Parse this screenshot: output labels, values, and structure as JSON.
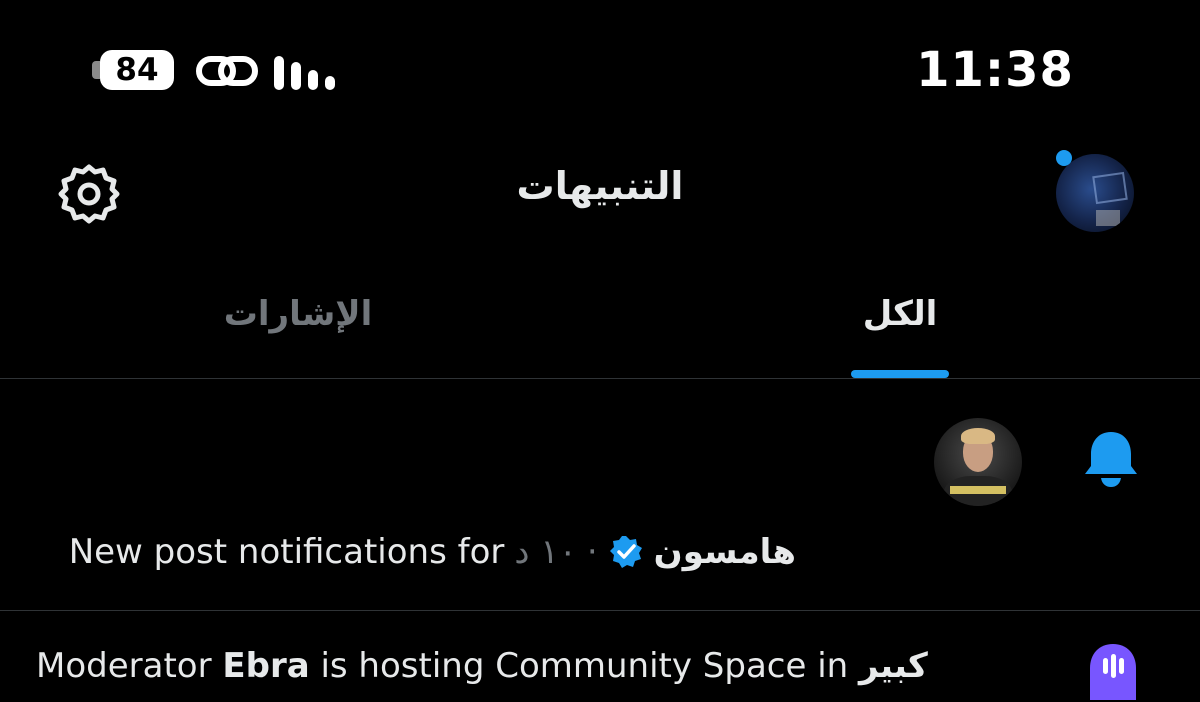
{
  "status_bar": {
    "battery": "84",
    "time": "11:38"
  },
  "header": {
    "title": "التنبيهات"
  },
  "tabs": [
    {
      "label": "الكل",
      "active": true
    },
    {
      "label": "الإشارات",
      "active": false
    }
  ],
  "notifications": [
    {
      "name": "هامسون",
      "time": "١٠ د",
      "text": "New post notifications for",
      "icon": "bell-icon",
      "verified": true
    },
    {
      "prefix": "Moderator ",
      "bold": "Ebra",
      "text": " is hosting Community Space in ",
      "suffix": "كبير",
      "icon": "spaces-icon"
    }
  ],
  "colors": {
    "accent": "#1d9bf0",
    "background": "#000000",
    "text": "#e7e9ea",
    "muted": "#71767b",
    "spaces": "#7856ff"
  }
}
